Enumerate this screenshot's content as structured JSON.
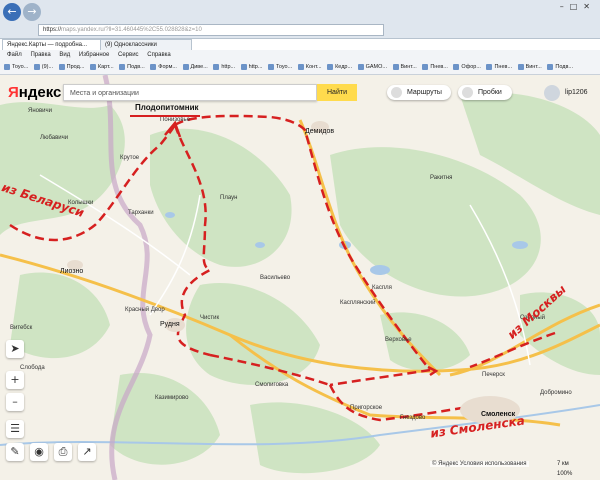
{
  "browser": {
    "url": "https://",
    "url_rest": "maps.yandex.ru/?ll=31.460445%2C55.028828&z=10",
    "tabs": [
      "Яндекс.Карты — подробна...",
      "(9) Одноклассники"
    ],
    "menu": [
      "Файл",
      "Правка",
      "Вид",
      "Избранное",
      "Сервис",
      "Справка"
    ],
    "favorites": [
      "Тоуо...",
      "(9)...",
      "Прод...",
      "Карт...",
      "Подв...",
      "Форм...",
      "Диве...",
      "http...",
      "http...",
      "Тоуо...",
      "Конт...",
      "Кедр...",
      "GAMO...",
      "Винт...",
      "Пнев...",
      "Офор...",
      "Пнев...",
      "Винт...",
      "Подв..."
    ]
  },
  "map_ui": {
    "logo_first": "Я",
    "logo_rest": "ндекс",
    "search_placeholder": "Места и организации",
    "find_button": "Найти",
    "routes_button": "Маршруты",
    "traffic_button": "Пробки",
    "username": "lip1206",
    "footer": "© Яндекс Условия использования",
    "scale": "7 км",
    "zoom": "100%"
  },
  "annotations": {
    "nursery": "Плодопитомник",
    "from_belarus": "из Беларуси",
    "from_moscow": "из Москвы",
    "from_smolensk": "из Смоленска"
  },
  "places": {
    "demidov": "Демидов",
    "rudnya": "Рудня",
    "liozno": "Лиозно",
    "smolensk": "Смоленск",
    "kaspliya": "Каспля",
    "ponizovye": "Понизовье",
    "krasny_dvor": "Красный Двор",
    "pechersk": "Печерск",
    "gnezdovo": "Гнездово",
    "yanovichi": "Яновичи",
    "vitebsk_side": "Витебск",
    "verkhovye": "Верховье",
    "kazimirovo": "Казимирово",
    "smolino": "Смолиговка",
    "prigorskoye": "Пригорское",
    "tarkhanki": "Тарханки",
    "kolyshki": "Колышки",
    "ozernyy": "Озерный",
    "rakitnya": "Ракитня",
    "chistik": "Чистик",
    "plaun": "Плаун",
    "sloboda": "Слобода",
    "dobromino": "Добромино",
    "krutoe": "Крутое",
    "lyubavichi": "Любавичи",
    "vasilyevo": "Васильево",
    "kasplya2": "Касплянский"
  },
  "colors": {
    "route": "#d62020",
    "forest": "#cfe4c3",
    "field": "#f4f1e8",
    "road": "#f5c04a",
    "water": "#a8c8e8",
    "border": "#c7a6c7"
  }
}
